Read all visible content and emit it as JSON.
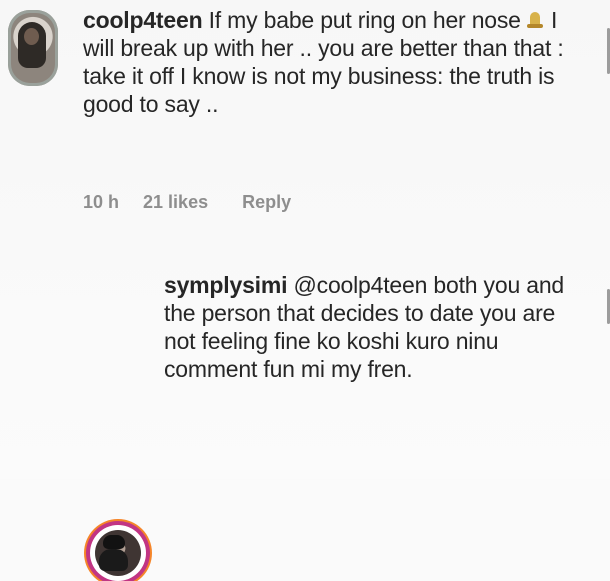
{
  "thread": {
    "parent": {
      "username": "coolp4teen",
      "text_before_emoji": " If my babe put ring on her nose",
      "emoji": "emoji",
      "text_after_emoji": " I will break up with her .. you are better than that : take it off I know is not my business: the truth is good to say ..",
      "meta": {
        "time": "10 h",
        "likes": "21 likes",
        "reply": "Reply"
      }
    },
    "reply": {
      "username": "symplysimi",
      "mention": "@coolp4teen",
      "text": " both you and the person that decides to date you are not feeling fine ko koshi kuro ninu comment fun mi my fren."
    }
  },
  "icons": {
    "parent_avatar": "avatar-icon",
    "reply_avatar": "avatar-icon",
    "emoji": "emoji-icon"
  },
  "colors": {
    "background": "#fafafa",
    "text": "#262626",
    "meta": "#8e8e8e",
    "story_ring_primary": "#c13584",
    "story_ring_secondary": "#f58529"
  }
}
